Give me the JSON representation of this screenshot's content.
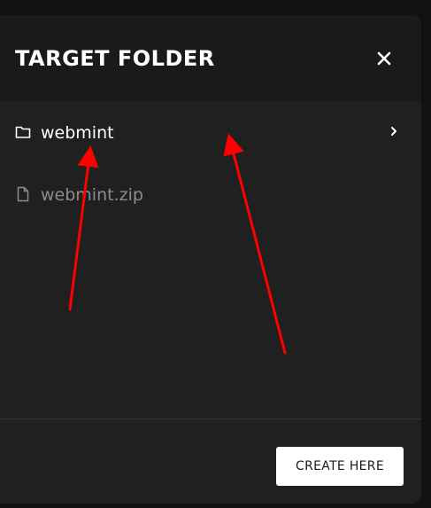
{
  "dialog": {
    "title": "TARGET FOLDER",
    "close_icon": "close-icon"
  },
  "items": [
    {
      "type": "folder",
      "label": "webmint",
      "icon": "folder-icon",
      "has_chevron": true
    },
    {
      "type": "file",
      "label": "webmint.zip",
      "icon": "file-icon",
      "has_chevron": false
    }
  ],
  "footer": {
    "create_label": "CREATE HERE"
  },
  "colors": {
    "annotation_arrow": "#ff0000",
    "dialog_bg": "#202020",
    "header_bg": "#1a1a1a"
  }
}
